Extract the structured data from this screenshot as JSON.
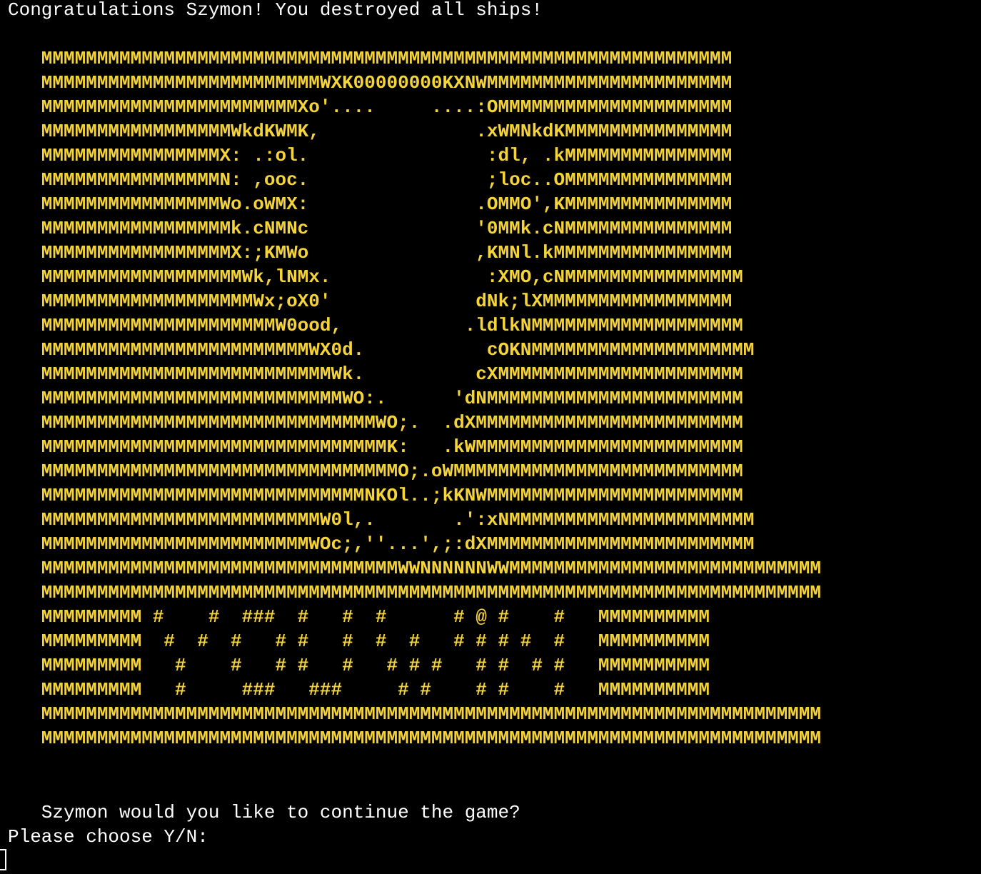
{
  "terminal": {
    "title_line": "Congratulations Szymon! You destroyed all ships!",
    "question_line": "   Szymon would you like to continue the game?",
    "prompt_line": "Please choose Y/N:",
    "text_color": "#ffffff",
    "art_color": "#f5d43a",
    "background_color": "#000000"
  },
  "ascii_art": {
    "lines": [
      "   MMMMMMMMMMMMMMMMMMMMMMMMMMMMMMMMMMMMMMMMMMMMMMMMMMMMMMMMMMMMMM",
      "   MMMMMMMMMMMMMMMMMMMMMMMMMWXK00000000KXNWMMMMMMMMMMMMMMMMMMMMMM",
      "   MMMMMMMMMMMMMMMMMMMMMMMXo'....     ....:OMMMMMMMMMMMMMMMMMMMMM",
      "   MMMMMMMMMMMMMMMMMWkdKWMK,              .xWMNkdKMMMMMMMMMMMMMMM",
      "   MMMMMMMMMMMMMMMMX: .:ol.                :dl, .kMMMMMMMMMMMMMMM",
      "   MMMMMMMMMMMMMMMMN: ,ooc.                ;loc..OMMMMMMMMMMMMMMM",
      "   MMMMMMMMMMMMMMMMWo.oWMX:               .OMMO',KMMMMMMMMMMMMMMM",
      "   MMMMMMMMMMMMMMMMMk.cNMNc               '0MMk.cNMMMMMMMMMMMMMMM",
      "   MMMMMMMMMMMMMMMMMX:;KMWo               ,KMNl.kMMMMMMMMMMMMMMMM",
      "   MMMMMMMMMMMMMMMMMMWk,lNMx.              :XMO,cNMMMMMMMMMMMMMMMM",
      "   MMMMMMMMMMMMMMMMMMMWx;oX0'             dNk;lXMMMMMMMMMMMMMMMMM",
      "   MMMMMMMMMMMMMMMMMMMMMW0ood,           .ldlkNMMMMMMMMMMMMMMMMMMM",
      "   MMMMMMMMMMMMMMMMMMMMMMMMWX0d.           cOKNMMMMMMMMMMMMMMMMMMMM",
      "   MMMMMMMMMMMMMMMMMMMMMMMMMMWk.          cXMMMMMMMMMMMMMMMMMMMMMM",
      "   MMMMMMMMMMMMMMMMMMMMMMMMMMMWO:.      'dNMMMMMMMMMMMMMMMMMMMMMMM",
      "   MMMMMMMMMMMMMMMMMMMMMMMMMMMMMMWO;.  .dXMMMMMMMMMMMMMMMMMMMMMMMM",
      "   MMMMMMMMMMMMMMMMMMMMMMMMMMMMMMMK:   .kWMMMMMMMMMMMMMMMMMMMMMMMM",
      "   MMMMMMMMMMMMMMMMMMMMMMMMMMMMMMMMO;.oWMMMMMMMMMMMMMMMMMMMMMMMMMM",
      "   MMMMMMMMMMMMMMMMMMMMMMMMMMMMMNKOl..;kKNWMMMMMMMMMMMMMMMMMMMMMMM",
      "   MMMMMMMMMMMMMMMMMMMMMMMMMW0l,.       .':xNMMMMMMMMMMMMMMMMMMMMMM",
      "   MMMMMMMMMMMMMMMMMMMMMMMMWOc;,''...',;:dXMMMMMMMMMMMMMMMMMMMMMMMM",
      "   MMMMMMMMMMMMMMMMMMMMMMMMMMMMMMMMWWNNNNNNWWMMMMMMMMMMMMMMMMMMMMMMMMMMMM",
      "   MMMMMMMMMMMMMMMMMMMMMMMMMMMMMMMMMMMMMMMMMMMMMMMMMMMMMMMMMMMMMMMMMMMMMM",
      "   MMMMMMMMM #    #  ###  #   #  #      # @ #    #   MMMMMMMMMM",
      "   MMMMMMMMM  #  #  #   # #   #  #  #   # # # #  #   MMMMMMMMMM",
      "   MMMMMMMMM   #    #   # #   #   # # #   # #  # #   MMMMMMMMMM",
      "   MMMMMMMMM   #     ###   ###     # #    # #    #   MMMMMMMMMM",
      "   MMMMMMMMMMMMMMMMMMMMMMMMMMMMMMMMMMMMMMMMMMMMMMMMMMMMMMMMMMMMMMMMMMMMMM",
      "   MMMMMMMMMMMMMMMMMMMMMMMMMMMMMMMMMMMMMMMMMMMMMMMMMMMMMMMMMMMMMMMMMMMMMM"
    ]
  }
}
